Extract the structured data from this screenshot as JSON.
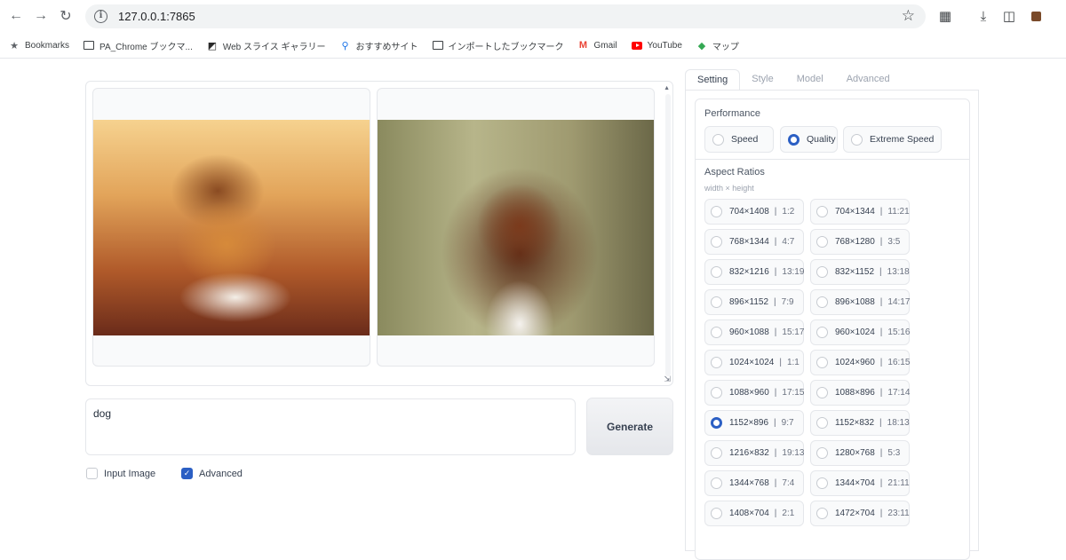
{
  "browser": {
    "url": "127.0.0.1:7865",
    "bookmarks": [
      {
        "label": "Bookmarks",
        "icon": "star-icon"
      },
      {
        "label": "PA_Chrome ブックマ...",
        "icon": "folder-icon"
      },
      {
        "label": "Web スライス ギャラリー",
        "icon": "web-slice-icon"
      },
      {
        "label": "おすすめサイト",
        "icon": "search-icon"
      },
      {
        "label": "インポートしたブックマーク",
        "icon": "folder-icon"
      },
      {
        "label": "Gmail",
        "icon": "gmail-icon"
      },
      {
        "label": "YouTube",
        "icon": "youtube-icon"
      },
      {
        "label": "マップ",
        "icon": "maps-icon"
      }
    ]
  },
  "prompt": {
    "value": "dog"
  },
  "generate_label": "Generate",
  "options": {
    "input_image_label": "Input Image",
    "advanced_label": "Advanced",
    "input_image_checked": false,
    "advanced_checked": true
  },
  "tabs": [
    "Setting",
    "Style",
    "Model",
    "Advanced"
  ],
  "performance": {
    "label": "Performance",
    "options": [
      "Speed",
      "Quality",
      "Extreme Speed"
    ],
    "selected": "Quality"
  },
  "aspect_ratios": {
    "label": "Aspect Ratios",
    "sublabel": "width × height",
    "selected": "1152×896",
    "items": [
      {
        "size": "704×1408",
        "ratio": "1:2"
      },
      {
        "size": "704×1344",
        "ratio": "11:21"
      },
      {
        "size": "768×1344",
        "ratio": "4:7"
      },
      {
        "size": "768×1280",
        "ratio": "3:5"
      },
      {
        "size": "832×1216",
        "ratio": "13:19"
      },
      {
        "size": "832×1152",
        "ratio": "13:18"
      },
      {
        "size": "896×1152",
        "ratio": "7:9"
      },
      {
        "size": "896×1088",
        "ratio": "14:17"
      },
      {
        "size": "960×1088",
        "ratio": "15:17"
      },
      {
        "size": "960×1024",
        "ratio": "15:16"
      },
      {
        "size": "1024×1024",
        "ratio": "1:1"
      },
      {
        "size": "1024×960",
        "ratio": "16:15"
      },
      {
        "size": "1088×960",
        "ratio": "17:15"
      },
      {
        "size": "1088×896",
        "ratio": "17:14"
      },
      {
        "size": "1152×896",
        "ratio": "9:7"
      },
      {
        "size": "1152×832",
        "ratio": "18:13"
      },
      {
        "size": "1216×832",
        "ratio": "19:13"
      },
      {
        "size": "1280×768",
        "ratio": "5:3"
      },
      {
        "size": "1344×768",
        "ratio": "7:4"
      },
      {
        "size": "1344×704",
        "ratio": "21:11"
      },
      {
        "size": "1408×704",
        "ratio": "2:1"
      },
      {
        "size": "1472×704",
        "ratio": "23:11"
      }
    ]
  },
  "colors": {
    "accent": "#2b5fc4",
    "border": "#e5e7eb"
  }
}
